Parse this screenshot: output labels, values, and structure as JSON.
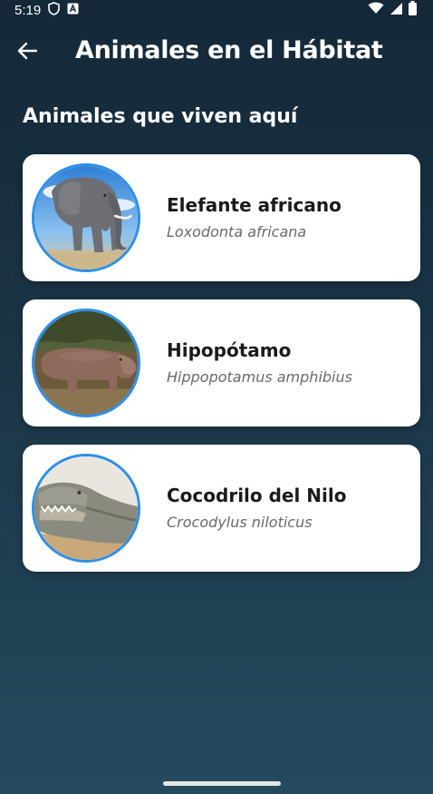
{
  "status_bar": {
    "time": "5:19",
    "icons": [
      "shield-icon",
      "a-badge-icon",
      "wifi-icon",
      "signal-icon",
      "battery-icon"
    ]
  },
  "app_bar": {
    "back_icon": "arrow-left-icon",
    "title": "Animales en el Hábitat"
  },
  "section": {
    "title": "Animales que viven aquí"
  },
  "animals": [
    {
      "name": "Elefante africano",
      "scientific": "Loxodonta africana",
      "image": "elephant-photo"
    },
    {
      "name": "Hipopótamo",
      "scientific": "Hippopotamus amphibius",
      "image": "hippo-photo"
    },
    {
      "name": "Cocodrilo del Nilo",
      "scientific": "Crocodylus niloticus",
      "image": "crocodile-photo"
    }
  ],
  "colors": {
    "background_top": "#142838",
    "background_bottom": "#254a5e",
    "card": "#ffffff",
    "avatar_border": "#2e8fe6",
    "name_text": "#1a1a1a",
    "scientific_text": "#6a6a6a"
  }
}
